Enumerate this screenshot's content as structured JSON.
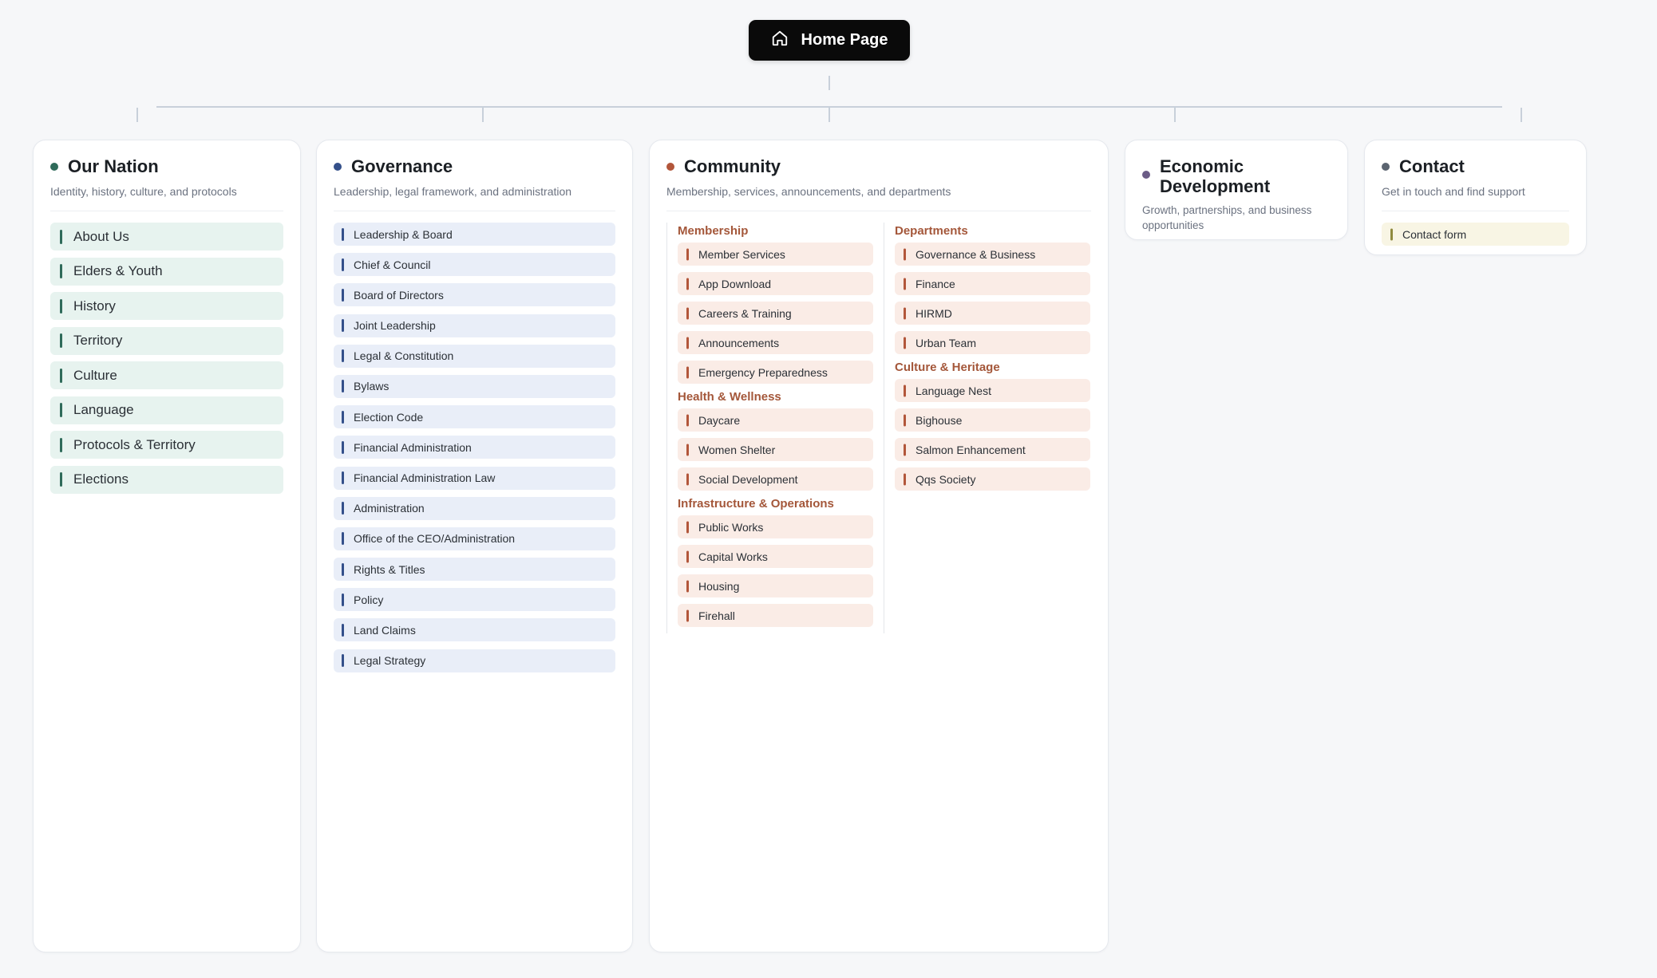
{
  "root": {
    "label": "Home Page",
    "icon": "home-icon"
  },
  "colors": {
    "nation": "#2f6b5a",
    "governance": "#34508a",
    "community": "#b2563a",
    "economic": "#6b5c86",
    "contact": "#5b6470"
  },
  "nation": {
    "title": "Our Nation",
    "subtitle": "Identity, history, culture, and protocols",
    "items": [
      "About Us",
      "Elders & Youth",
      "History",
      "Territory",
      "Culture",
      "Language",
      "Protocols & Territory",
      "Elections"
    ]
  },
  "governance": {
    "title": "Governance",
    "subtitle": "Leadership, legal framework, and administration",
    "items": [
      "Leadership & Board",
      "Chief & Council",
      "Board of Directors",
      "Joint Leadership",
      "Legal & Constitution",
      "Bylaws",
      "Election Code",
      "Financial Administration",
      "Financial Administration Law",
      "Administration",
      "Office of the CEO/Administration",
      "Rights & Titles",
      "Policy",
      "Land Claims",
      "Legal Strategy"
    ]
  },
  "community": {
    "title": "Community",
    "subtitle": "Membership, services, announcements, and departments",
    "left_groups": [
      {
        "title": "Membership",
        "items": [
          "Member Services",
          "App Download",
          "Careers & Training",
          "Announcements",
          "Emergency Preparedness"
        ]
      },
      {
        "title": "Health & Wellness",
        "items": [
          "Daycare",
          "Women Shelter",
          "Social Development"
        ]
      },
      {
        "title": "Infrastructure & Operations",
        "items": [
          "Public Works",
          "Capital Works",
          "Housing",
          "Firehall"
        ]
      }
    ],
    "right_groups": [
      {
        "title": "Departments",
        "items": [
          "Governance & Business",
          "Finance",
          "HIRMD",
          "Urban Team"
        ]
      },
      {
        "title": "Culture & Heritage",
        "items": [
          "Language Nest",
          "Bighouse",
          "Salmon Enhancement",
          "Qqs Society"
        ]
      }
    ]
  },
  "economic": {
    "title": "Economic Development",
    "subtitle": "Growth, partnerships, and business opportunities"
  },
  "contact": {
    "title": "Contact",
    "subtitle": "Get in touch and find support",
    "items": [
      "Contact form"
    ]
  }
}
